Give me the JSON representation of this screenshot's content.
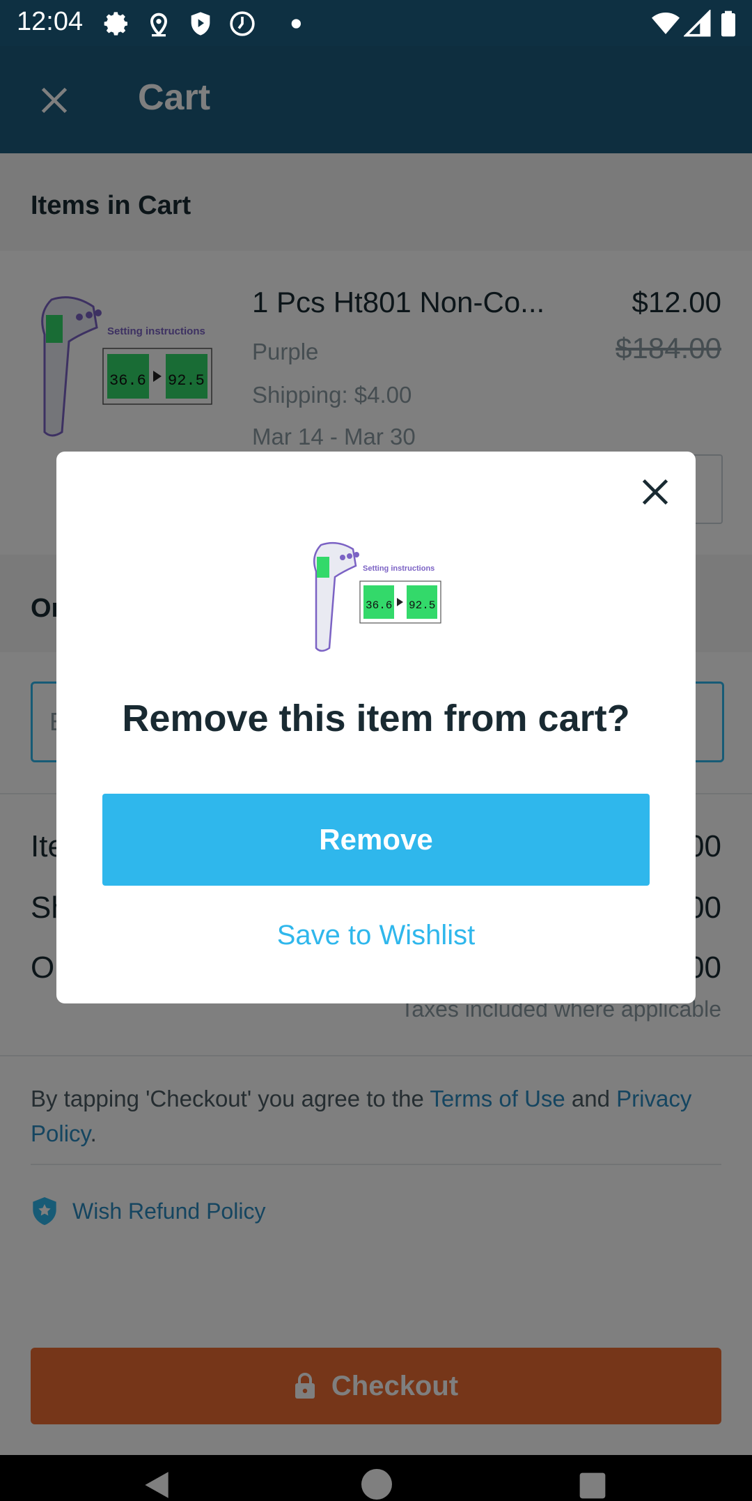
{
  "status_bar": {
    "time": "12:04",
    "icons": [
      "settings-icon",
      "location-icon",
      "shield-play-icon",
      "clock-icon",
      "dot-icon",
      "wifi-icon",
      "signal-icon",
      "battery-icon"
    ]
  },
  "app_bar": {
    "close_icon": "close-icon",
    "title": "Cart"
  },
  "items_section": {
    "title": "Items in Cart"
  },
  "cart_item": {
    "name": "1 Pcs Ht801 Non-Co...",
    "price": "$12.00",
    "original_price": "$184.00",
    "variant": "Purple",
    "shipping": "Shipping: $4.00",
    "delivery": "Mar 14 - Mar 30",
    "image_text": {
      "title": "Setting instructions",
      "readout_left": "36.6",
      "readout_right": "92.5"
    }
  },
  "order_section": {
    "title_visible": "Or"
  },
  "promo": {
    "placeholder_visible": "E"
  },
  "summary": {
    "rows": [
      {
        "label_visible": "Ite",
        "value_visible": "00"
      },
      {
        "label_visible": "Sh",
        "value_visible": "00"
      },
      {
        "label_visible": "O",
        "value_visible": "00"
      }
    ],
    "taxes_note": "Taxes included where applicable"
  },
  "legal": {
    "prefix": "By tapping 'Checkout' you agree to the ",
    "terms": "Terms of Use",
    "and": " and ",
    "privacy": "Privacy Policy",
    "suffix": "."
  },
  "refund": {
    "label": "Wish Refund Policy"
  },
  "checkout": {
    "label": "Checkout"
  },
  "dialog": {
    "question": "Remove this item from cart?",
    "remove_label": "Remove",
    "wishlist_label": "Save to Wishlist"
  },
  "colors": {
    "app_bar": "#1d5d7e",
    "accent": "#2fb7ec",
    "checkout": "#ec6d33",
    "link": "#2a8bc0"
  }
}
